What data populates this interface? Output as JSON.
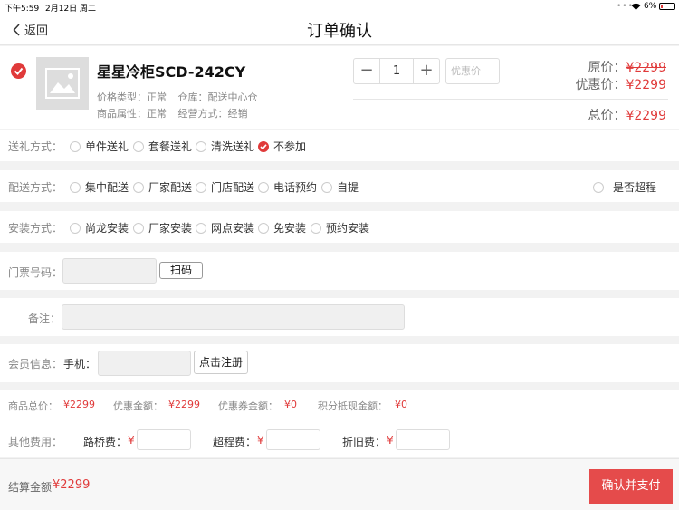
{
  "statusbar": {
    "time": "下午5:59",
    "date": "2月12日 周二",
    "battery": "6%"
  },
  "nav": {
    "back_label": "返回",
    "title": "订单确认"
  },
  "product": {
    "name": "星星冷柜SCD-242CY",
    "price_type_label": "价格类型：",
    "price_type": "正常",
    "warehouse_label": "仓库：",
    "warehouse": "配送中心仓",
    "attr_label": "商品属性：",
    "attr": "正常",
    "mode_label": "经营方式：",
    "mode": "经销",
    "quantity": "1",
    "discount_placeholder": "优惠价",
    "original_label": "原价：",
    "original_price": "¥2299",
    "discount_label": "优惠价：",
    "discount_price": "¥2299",
    "total_label": "总价：",
    "total_price": "¥2299"
  },
  "gift": {
    "label": "送礼方式：",
    "options": [
      "单件送礼",
      "套餐送礼",
      "清洗送礼",
      "不参加"
    ],
    "selected": 3
  },
  "delivery": {
    "label": "配送方式：",
    "options": [
      "集中配送",
      "厂家配送",
      "门店配送",
      "电话预约",
      "自提"
    ],
    "overrange": "是否超程"
  },
  "install": {
    "label": "安装方式：",
    "options": [
      "尚龙安装",
      "厂家安装",
      "网点安装",
      "免安装",
      "预约安装"
    ]
  },
  "ticket": {
    "label": "门票号码：",
    "scan_label": "扫码"
  },
  "remark": {
    "label": "备注："
  },
  "member": {
    "label": "会员信息：",
    "phone_label": "手机：",
    "register_label": "点击注册"
  },
  "summary": {
    "total_label": "商品总价：",
    "total": "¥2299",
    "discount_label": "优惠金额：",
    "discount": "¥2299",
    "coupon_label": "优惠券金额：",
    "coupon": "¥0",
    "points_label": "积分抵现金额：",
    "points": "¥0"
  },
  "fees": {
    "label": "其他费用：",
    "road_label": "路桥费：",
    "over_label": "超程费：",
    "old_label": "折旧费：",
    "currency": "¥"
  },
  "footer": {
    "settle_label": "结算金额",
    "settle_amount": "¥2299",
    "confirm_label": "确认并支付"
  },
  "colors": {
    "accent": "#e03a3a"
  }
}
